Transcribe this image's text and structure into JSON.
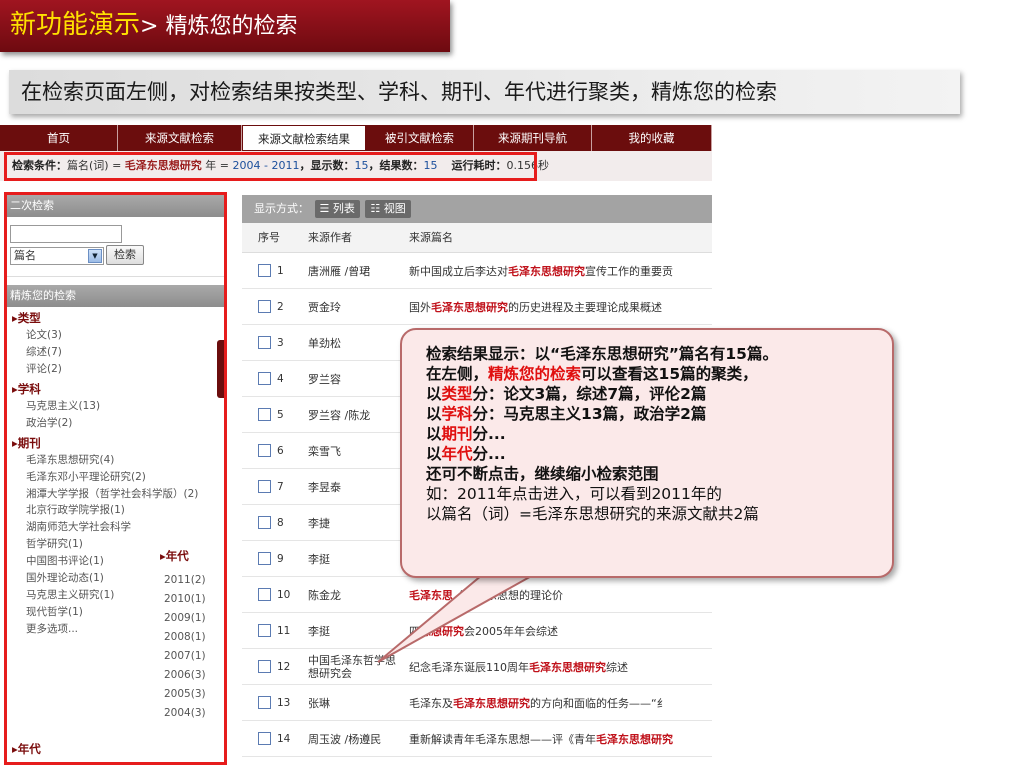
{
  "slide": {
    "title_main": "新功能演示",
    "title_rest": "> 精炼您的检索",
    "subtitle": "在检索页面左侧，对检索结果按类型、学科、期刊、年代进行聚类，精炼您的检索"
  },
  "nav": {
    "tabs": [
      "首页",
      "来源文献检索",
      "来源文献检索结果",
      "被引文献检索",
      "来源期刊导航",
      "我的收藏"
    ],
    "active_index": 2
  },
  "conditions": {
    "label": "检索条件：",
    "field": "篇名(词) = ",
    "term": "毛泽东思想研究",
    "year_label": " 年 = ",
    "year_range": "2004 - 2011",
    "shown_label": "，显示数：",
    "shown": "15",
    "result_label": "，结果数：",
    "result": "15",
    "time_label": "运行耗时：",
    "time": "0.156秒"
  },
  "secondary_search": {
    "header": "二次检索",
    "input_value": "",
    "select_value": "篇名",
    "button": "检索"
  },
  "refine": {
    "header": "精炼您的检索",
    "type_title": "▸类型",
    "types": [
      "论文(3)",
      "综述(7)",
      "评论(2)"
    ],
    "subject_title": "▸学科",
    "subjects": [
      "马克思主义(13)",
      "政治学(2)"
    ],
    "journal_title": "▸期刊",
    "journals": [
      "毛泽东思想研究(4)",
      "毛泽东邓小平理论研究(2)",
      "湘潭大学学报（哲学社会科学版）(2)",
      "北京行政学院学报(1)",
      "湖南师范大学社会科学",
      "哲学研究(1)",
      "中国图书评论(1)",
      "国外理论动态(1)",
      "马克思主义研究(1)",
      "现代哲学(1)",
      "更多选项..."
    ],
    "year_title": "▸年代",
    "years": [
      "2011(2)",
      "2010(1)",
      "2009(1)",
      "2008(1)",
      "2007(1)",
      "2006(3)",
      "2005(3)",
      "2004(3)"
    ],
    "bottom_title": "▸年代"
  },
  "results": {
    "display_label": "显示方式：",
    "list_label": "列表",
    "view_label": "视图",
    "headers": [
      "序号",
      "来源作者",
      "来源篇名"
    ],
    "rows": [
      {
        "no": "1",
        "author": "唐洲雁 /曾珺",
        "pre": "新中国成立后李达对",
        "kw": "毛泽东思想研究",
        "post": "宣传工作的重要贡"
      },
      {
        "no": "2",
        "author": "贾金玲",
        "pre": "国外",
        "kw": "毛泽东思想研究",
        "post": "的历史进程及主要理论成果概述"
      },
      {
        "no": "3",
        "author": "单劲松",
        "pre": "",
        "kw": "",
        "post": ""
      },
      {
        "no": "4",
        "author": "罗兰容",
        "pre": "",
        "kw": "",
        "post": ""
      },
      {
        "no": "5",
        "author": "罗兰容 /陈龙",
        "pre": "",
        "kw": "",
        "post": ""
      },
      {
        "no": "6",
        "author": "栾雪飞",
        "pre": "",
        "kw": "",
        "post": ""
      },
      {
        "no": "7",
        "author": "李昱泰",
        "pre": "",
        "kw": "",
        "post": ""
      },
      {
        "no": "8",
        "author": "李捷",
        "pre": "",
        "kw": "",
        "post": ""
      },
      {
        "no": "9",
        "author": "李挺",
        "pre": "",
        "kw": "",
        "post": ""
      },
      {
        "no": "10",
        "author": "陈金龙",
        "pre": "",
        "kw": "毛泽东思",
        "post": "《毛泽东思想的理论价"
      },
      {
        "no": "11",
        "author": "李挺",
        "pre": "四",
        "kw": "思想研究",
        "post": "会2005年年会综述"
      },
      {
        "no": "12",
        "author": "中国毛泽东哲学思想研究会",
        "pre": "纪念毛泽东诞辰110周年",
        "kw": "毛泽东思想研究",
        "post": "综述"
      },
      {
        "no": "13",
        "author": "张琳",
        "pre": "毛泽东及",
        "kw": "毛泽东思想研究",
        "post": "的方向和面临的任务——“纟"
      },
      {
        "no": "14",
        "author": "周玉波 /杨遵民",
        "pre": "重新解读青年毛泽东思想——评《青年",
        "kw": "毛泽东思想研究",
        "post": ""
      },
      {
        "no": "15",
        "author": "单孝虹",
        "pre": "2004年度四川省",
        "kw": "毛泽东思想研究",
        "post": "会年会综述"
      }
    ]
  },
  "callout": {
    "l1": "检索结果显示：以“毛泽东思想研究”篇名有15篇。",
    "l2a": "在左侧，",
    "l2b": "精炼您的检索",
    "l2c": "可以查看这15篇的聚类，",
    "l3a": "以",
    "l3b": "类型",
    "l3c": "分：论文3篇，综述7篇，评伦2篇",
    "l4a": "以",
    "l4b": "学科",
    "l4c": "分：马克思主义13篇，政治学2篇",
    "l5a": "以",
    "l5b": "期刊",
    "l5c": "分...",
    "l6a": "以",
    "l6b": "年代",
    "l6c": "分...",
    "l7": "还可不断点击，继续缩小检索范围",
    "l8": "如：2011年点击进入，可以看到2011年的",
    "l9": "以篇名（词）=毛泽东思想研究的来源文献共2篇"
  },
  "colors": {
    "brand": "#6b0d0d",
    "highlight": "#e61c1c",
    "keyword": "#c0121b"
  }
}
